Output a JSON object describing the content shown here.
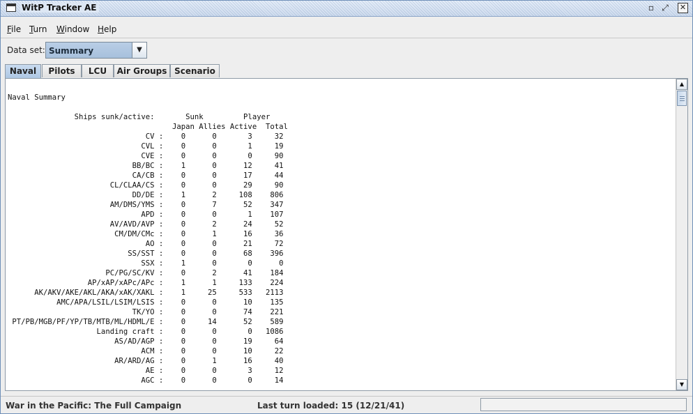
{
  "window": {
    "title": "WitP Tracker AE",
    "controls": {
      "minimize": "▫",
      "maximize": "⤢",
      "close": "✕"
    }
  },
  "menubar": [
    {
      "mnemonic": "F",
      "rest": "ile"
    },
    {
      "mnemonic": "T",
      "rest": "urn"
    },
    {
      "mnemonic": "W",
      "rest": "indow"
    },
    {
      "mnemonic": "H",
      "rest": "elp"
    }
  ],
  "dataset": {
    "label": "Data set:",
    "value": "Summary",
    "arrow": "▼"
  },
  "tabs": [
    {
      "label": "Naval",
      "active": true
    },
    {
      "label": "Pilots",
      "active": false
    },
    {
      "label": "LCU",
      "active": false
    },
    {
      "label": "Air Groups",
      "active": false
    },
    {
      "label": "Scenario",
      "active": false
    }
  ],
  "content": {
    "heading": "Naval Summary",
    "header_line": "Ships sunk/active:",
    "group_sunk": "Sunk",
    "group_player": "Player",
    "columns": [
      "Japan",
      "Allies",
      "Active",
      "Total"
    ],
    "rows": [
      {
        "type": "CV",
        "japan": "0",
        "allies": "0",
        "active": "3",
        "total": "32"
      },
      {
        "type": "CVL",
        "japan": "0",
        "allies": "0",
        "active": "1",
        "total": "19"
      },
      {
        "type": "CVE",
        "japan": "0",
        "allies": "0",
        "active": "0",
        "total": "90"
      },
      {
        "type": "BB/BC",
        "japan": "1",
        "allies": "0",
        "active": "12",
        "total": "41"
      },
      {
        "type": "CA/CB",
        "japan": "0",
        "allies": "0",
        "active": "17",
        "total": "44"
      },
      {
        "type": "CL/CLAA/CS",
        "japan": "0",
        "allies": "0",
        "active": "29",
        "total": "90"
      },
      {
        "type": "DD/DE",
        "japan": "1",
        "allies": "2",
        "active": "108",
        "total": "806"
      },
      {
        "type": "AM/DMS/YMS",
        "japan": "0",
        "allies": "7",
        "active": "52",
        "total": "347"
      },
      {
        "type": "APD",
        "japan": "0",
        "allies": "0",
        "active": "1",
        "total": "107"
      },
      {
        "type": "AV/AVD/AVP",
        "japan": "0",
        "allies": "2",
        "active": "24",
        "total": "52"
      },
      {
        "type": "CM/DM/CMc",
        "japan": "0",
        "allies": "1",
        "active": "16",
        "total": "36"
      },
      {
        "type": "AO",
        "japan": "0",
        "allies": "0",
        "active": "21",
        "total": "72"
      },
      {
        "type": "SS/SST",
        "japan": "0",
        "allies": "0",
        "active": "68",
        "total": "396"
      },
      {
        "type": "SSX",
        "japan": "1",
        "allies": "0",
        "active": "0",
        "total": "0"
      },
      {
        "type": "PC/PG/SC/KV",
        "japan": "0",
        "allies": "2",
        "active": "41",
        "total": "184"
      },
      {
        "type": "AP/xAP/xAPc/APc",
        "japan": "1",
        "allies": "1",
        "active": "133",
        "total": "224"
      },
      {
        "type": "AK/AKV/AKE/AKL/AKA/xAK/XAKL",
        "japan": "1",
        "allies": "25",
        "active": "533",
        "total": "2113"
      },
      {
        "type": "AMC/APA/LSIL/LSIM/LSIS",
        "japan": "0",
        "allies": "0",
        "active": "10",
        "total": "135"
      },
      {
        "type": "TK/YO",
        "japan": "0",
        "allies": "0",
        "active": "74",
        "total": "221"
      },
      {
        "type": "PT/PB/MGB/PF/YP/TB/MTB/ML/HDML/E",
        "japan": "0",
        "allies": "14",
        "active": "52",
        "total": "589"
      },
      {
        "type": "Landing craft",
        "japan": "0",
        "allies": "0",
        "active": "0",
        "total": "1086"
      },
      {
        "type": "AS/AD/AGP",
        "japan": "0",
        "allies": "0",
        "active": "19",
        "total": "64"
      },
      {
        "type": "ACM",
        "japan": "0",
        "allies": "0",
        "active": "10",
        "total": "22"
      },
      {
        "type": "AR/ARD/AG",
        "japan": "0",
        "allies": "1",
        "active": "16",
        "total": "40"
      },
      {
        "type": "AE",
        "japan": "0",
        "allies": "0",
        "active": "3",
        "total": "12"
      },
      {
        "type": "AGC",
        "japan": "0",
        "allies": "0",
        "active": "0",
        "total": "14"
      }
    ]
  },
  "scrollbar": {
    "up": "▲",
    "down": "▼"
  },
  "status": {
    "campaign": "War in the Pacific: The Full Campaign",
    "last_turn": "Last turn loaded: 15 (12/21/41)"
  }
}
